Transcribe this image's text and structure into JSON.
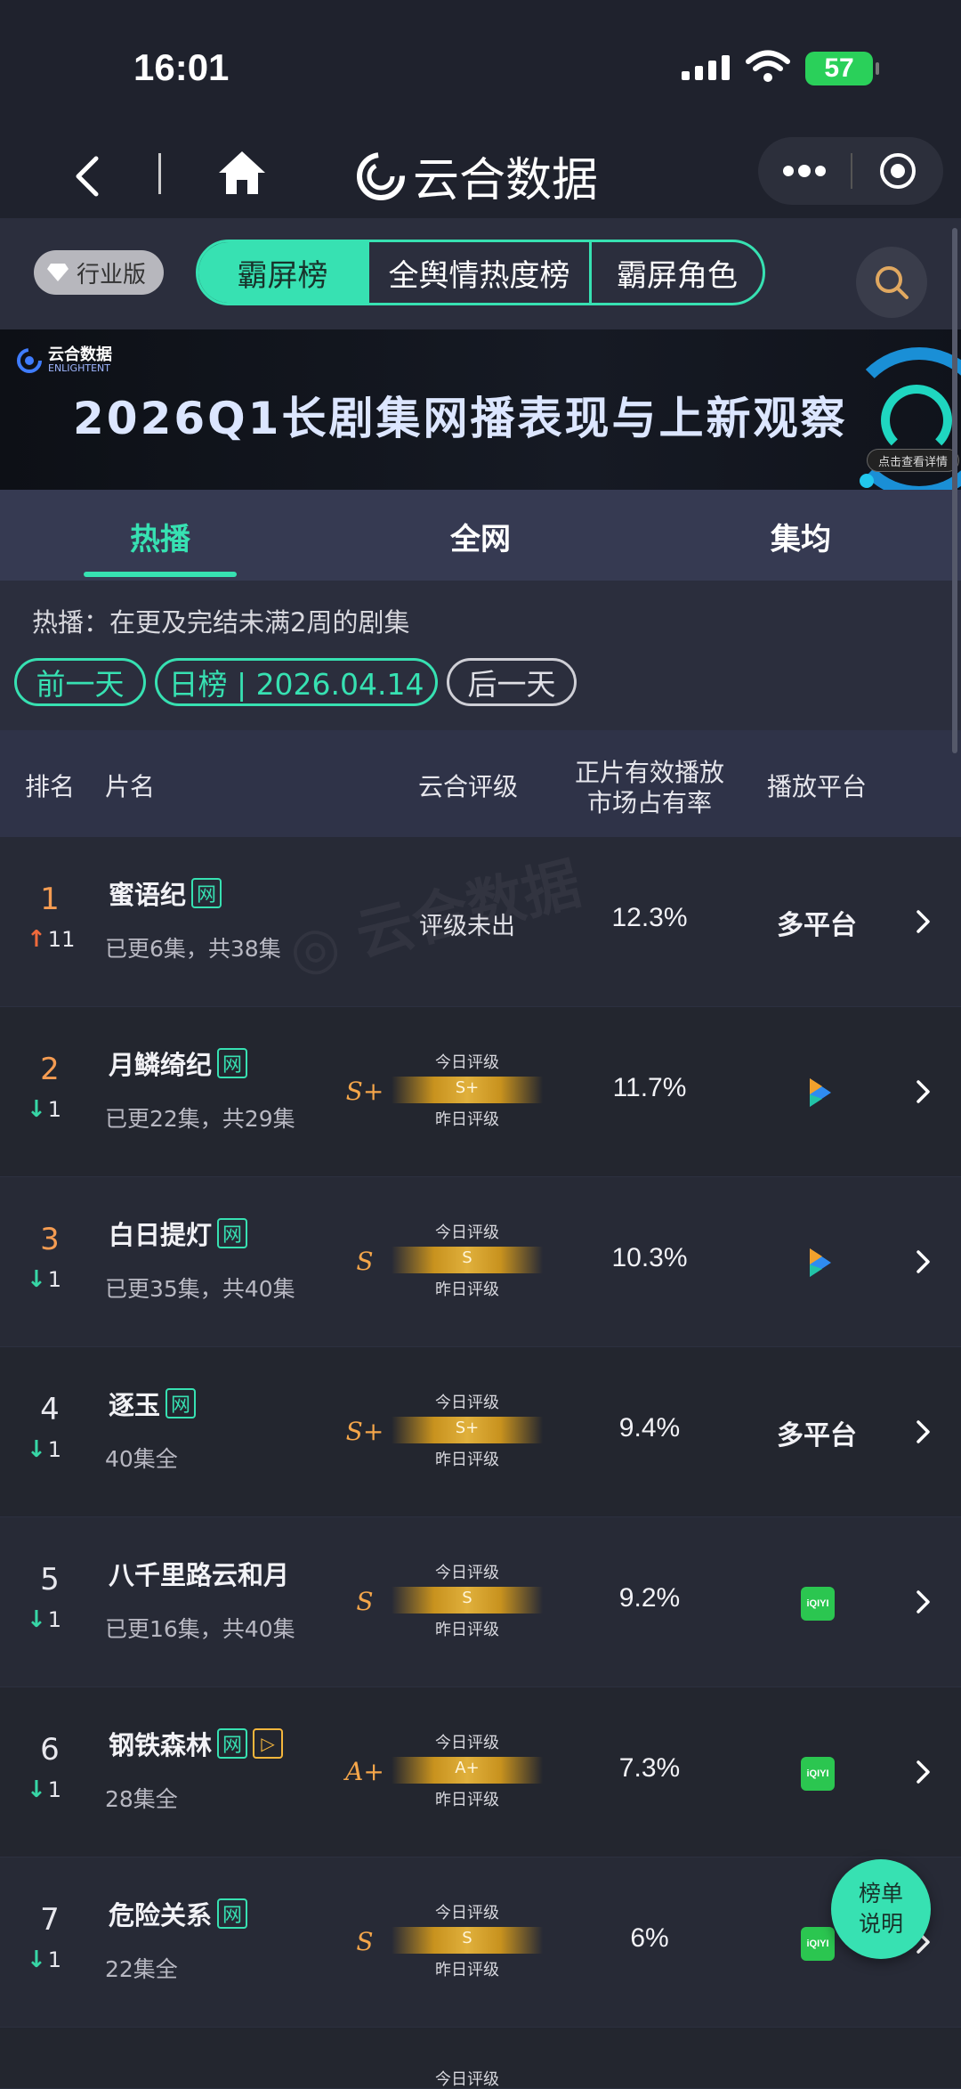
{
  "status": {
    "time": "16:01",
    "battery": "57"
  },
  "nav": {
    "title": "云合数据"
  },
  "filters": {
    "edition": "行业版",
    "segments": [
      "霸屏榜",
      "全舆情热度榜",
      "霸屏角色"
    ]
  },
  "banner": {
    "logo_text": "云合数据",
    "logo_sub": "ENLIGHTENT",
    "title": "2026Q1长剧集网播表现与上新观察",
    "cta": "点击查看详情"
  },
  "tabs": [
    "热播",
    "全网",
    "集均"
  ],
  "subinfo": {
    "description": "热播：在更及完结未满2周的剧集",
    "prev": "前一天",
    "current": "日榜 | 2026.04.14",
    "next": "后一天"
  },
  "table": {
    "headers": {
      "rank": "排名",
      "title": "片名",
      "grade": "云合评级",
      "share_line1": "正片有效播放",
      "share_line2": "市场占有率",
      "platform": "播放平台"
    },
    "grade_today_label": "今日评级",
    "grade_yesterday_label": "昨日评级",
    "net_badge": "网",
    "rows": [
      {
        "rank": "1",
        "change": "11",
        "direction": "up",
        "title": "蜜语纪",
        "episodes": "已更6集，共38集",
        "grade": "",
        "grade_text": "评级未出",
        "share": "12.3%",
        "platform": "多平台",
        "platform_type": "text"
      },
      {
        "rank": "2",
        "change": "1",
        "direction": "down",
        "title": "月鳞绮纪",
        "episodes": "已更22集，共29集",
        "grade": "S+",
        "grade_text": "",
        "share": "11.7%",
        "platform": "",
        "platform_type": "tencent"
      },
      {
        "rank": "3",
        "change": "1",
        "direction": "down",
        "title": "白日提灯",
        "episodes": "已更35集，共40集",
        "grade": "S",
        "grade_text": "",
        "share": "10.3%",
        "platform": "",
        "platform_type": "tencent"
      },
      {
        "rank": "4",
        "change": "1",
        "direction": "down",
        "title": "逐玉",
        "episodes": "40集全",
        "grade": "S+",
        "grade_text": "",
        "share": "9.4%",
        "platform": "多平台",
        "platform_type": "text"
      },
      {
        "rank": "5",
        "change": "1",
        "direction": "down",
        "title": "八千里路云和月",
        "episodes": "已更16集，共40集",
        "grade": "S",
        "grade_text": "",
        "share": "9.2%",
        "platform": "iQIYI",
        "platform_type": "iqiyi"
      },
      {
        "rank": "6",
        "change": "1",
        "direction": "down",
        "title": "钢铁森林",
        "episodes": "28集全",
        "grade": "A+",
        "grade_text": "",
        "share": "7.3%",
        "platform": "iQIYI",
        "platform_type": "iqiyi"
      },
      {
        "rank": "7",
        "change": "1",
        "direction": "down",
        "title": "危险关系",
        "episodes": "22集全",
        "grade": "S",
        "grade_text": "",
        "share": "6%",
        "platform": "iQIYI",
        "platform_type": "iqiyi"
      }
    ]
  },
  "float_button": {
    "line1": "榜单",
    "line2": "说明"
  },
  "colors": {
    "accent": "#37e1b2",
    "rank_top": "#f59c52",
    "grade": "#f5a64a",
    "up": "#f06a3c",
    "down": "#37d6a6"
  }
}
